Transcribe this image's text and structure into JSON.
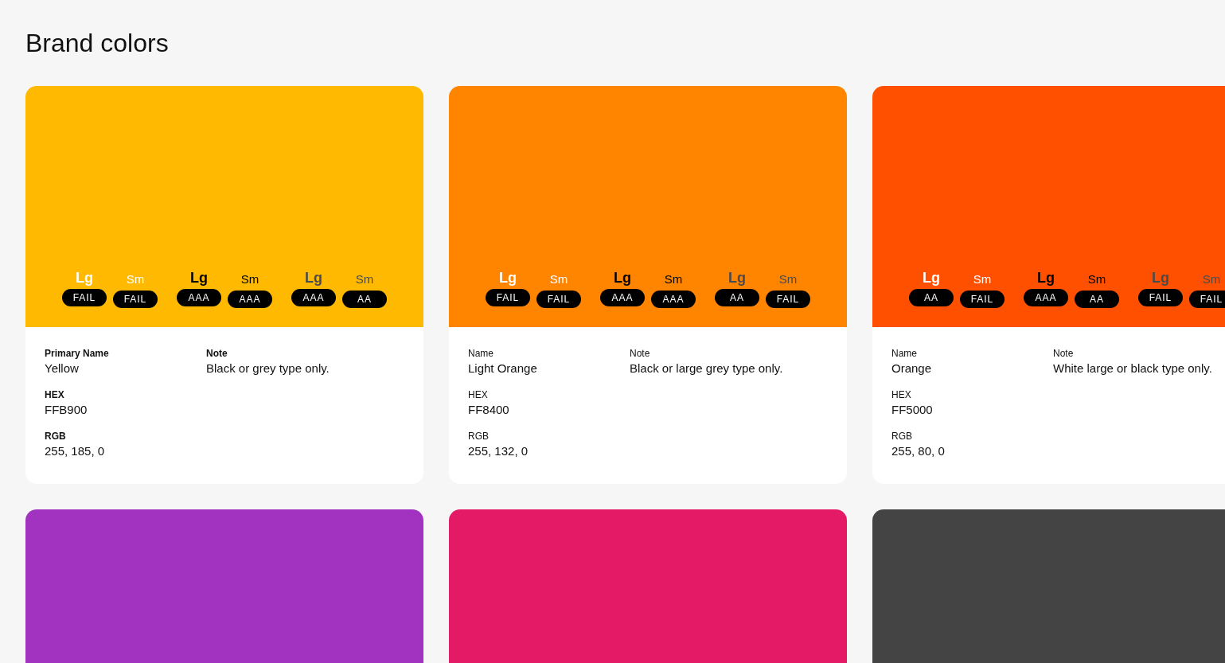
{
  "title": "Brand colors",
  "cards": [
    {
      "color": "#ffb900",
      "tests": [
        {
          "color": "#ffffff",
          "large_label": "Lg",
          "lg": "FAIL",
          "small_label": "Sm",
          "sm": "FAIL"
        },
        {
          "color": "#000000",
          "large_label": "Lg",
          "lg": "AAA",
          "small_label": "Sm",
          "sm": "AAA"
        },
        {
          "color": "#4a4a4a",
          "large_label": "Lg",
          "lg": "AAA",
          "small_label": "Sm",
          "sm": "AA"
        }
      ],
      "labels_bold": true,
      "fields": [
        {
          "label": "Primary Name",
          "value": "Yellow"
        },
        {
          "label": "HEX",
          "value": "FFB900"
        },
        {
          "label": "RGB",
          "value": "255, 185, 0"
        }
      ],
      "note": {
        "label": "Note",
        "value": "Black or grey type only."
      }
    },
    {
      "color": "#ff8400",
      "tests": [
        {
          "color": "#ffffff",
          "large_label": "Lg",
          "lg": "FAIL",
          "small_label": "Sm",
          "sm": "FAIL"
        },
        {
          "color": "#000000",
          "large_label": "Lg",
          "lg": "AAA",
          "small_label": "Sm",
          "sm": "AAA"
        },
        {
          "color": "#4a4a4a",
          "large_label": "Lg",
          "lg": "AA",
          "small_label": "Sm",
          "sm": "FAIL"
        }
      ],
      "labels_bold": false,
      "fields": [
        {
          "label": "Name",
          "value": "Light Orange"
        },
        {
          "label": "HEX",
          "value": "FF8400"
        },
        {
          "label": "RGB",
          "value": "255, 132, 0"
        }
      ],
      "note": {
        "label": "Note",
        "value": "Black or large grey type only."
      }
    },
    {
      "color": "#ff5000",
      "tests": [
        {
          "color": "#ffffff",
          "large_label": "Lg",
          "lg": "AA",
          "small_label": "Sm",
          "sm": "FAIL"
        },
        {
          "color": "#000000",
          "large_label": "Lg",
          "lg": "AAA",
          "small_label": "Sm",
          "sm": "AA"
        },
        {
          "color": "#4a4a4a",
          "large_label": "Lg",
          "lg": "FAIL",
          "small_label": "Sm",
          "sm": "FAIL"
        }
      ],
      "labels_bold": false,
      "fields": [
        {
          "label": "Name",
          "value": "Orange"
        },
        {
          "label": "HEX",
          "value": "FF5000"
        },
        {
          "label": "RGB",
          "value": "255, 80, 0"
        }
      ],
      "note": {
        "label": "Note",
        "value": "White large or black type only."
      }
    },
    {
      "color": "#a232c0"
    },
    {
      "color": "#e41a67"
    },
    {
      "color": "#444444"
    }
  ]
}
